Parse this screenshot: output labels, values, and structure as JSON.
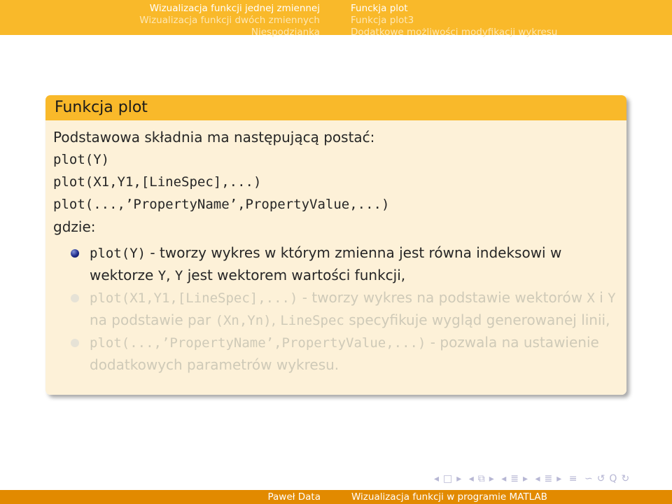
{
  "header": {
    "left_items": [
      {
        "label": "Wizualizacja funkcji jednej zmiennej",
        "current": true
      },
      {
        "label": "Wizualizacja funkcji dwóch zmiennych",
        "current": false
      },
      {
        "label": "Niespodzianka",
        "current": false
      }
    ],
    "right_items": [
      {
        "label": "Funckja plot",
        "current": true
      },
      {
        "label": "Funkcja plot3",
        "current": false
      },
      {
        "label": "Dodatkowe możliwości modyfikacji wykresu",
        "current": false
      }
    ]
  },
  "block": {
    "title": "Funkcja plot",
    "intro": "Podstawowa składnia ma następującą postać:",
    "syntax": [
      "plot(Y)",
      "plot(X1,Y1,[LineSpec],...)",
      "plot(...,’PropertyName’,PropertyValue,...)"
    ],
    "where": "gdzie:",
    "items": [
      {
        "code": "plot(Y)",
        "text1": " - tworzy wykres w którym zmienna jest równa indeksowi w wektorze ",
        "code2": "Y",
        "text2": ", ",
        "code3": "Y",
        "text3": " jest wektorem wartości funkcji,",
        "state": "active"
      },
      {
        "code": "plot(X1,Y1,[LineSpec],...)",
        "text1": " - tworzy wykres na podstawie wektorów ",
        "code2": "X",
        "text2": " i ",
        "code3": "Y",
        "text3": " na podstawie par ",
        "code4": "(Xn,Yn)",
        "text4": ", ",
        "code5": "LineSpec",
        "text5": " specyfikuje wygląd generowanej linii,",
        "state": "faded"
      },
      {
        "code": "plot(...,’PropertyName’,PropertyValue,...)",
        "text1": " - pozwala na ustawienie dodatkowych parametrów wykresu.",
        "state": "faded"
      }
    ]
  },
  "nav_symbols": [
    "◂",
    "□",
    "▸",
    "◂",
    "⧉",
    "▸",
    "◂",
    "≣",
    "▸",
    "◂",
    "≣",
    "▸",
    "≡",
    "∽",
    "↺",
    "Q",
    "↻"
  ],
  "footer": {
    "author": "Paweł Data",
    "title": "Wizualizacja funkcji w programie MATLAB"
  },
  "colors": {
    "header_bg": "#f9b92a",
    "footer_bg": "#e28a00",
    "block_body_bg": "#fdf1d8",
    "bullet_active": "#1f2c8a"
  }
}
